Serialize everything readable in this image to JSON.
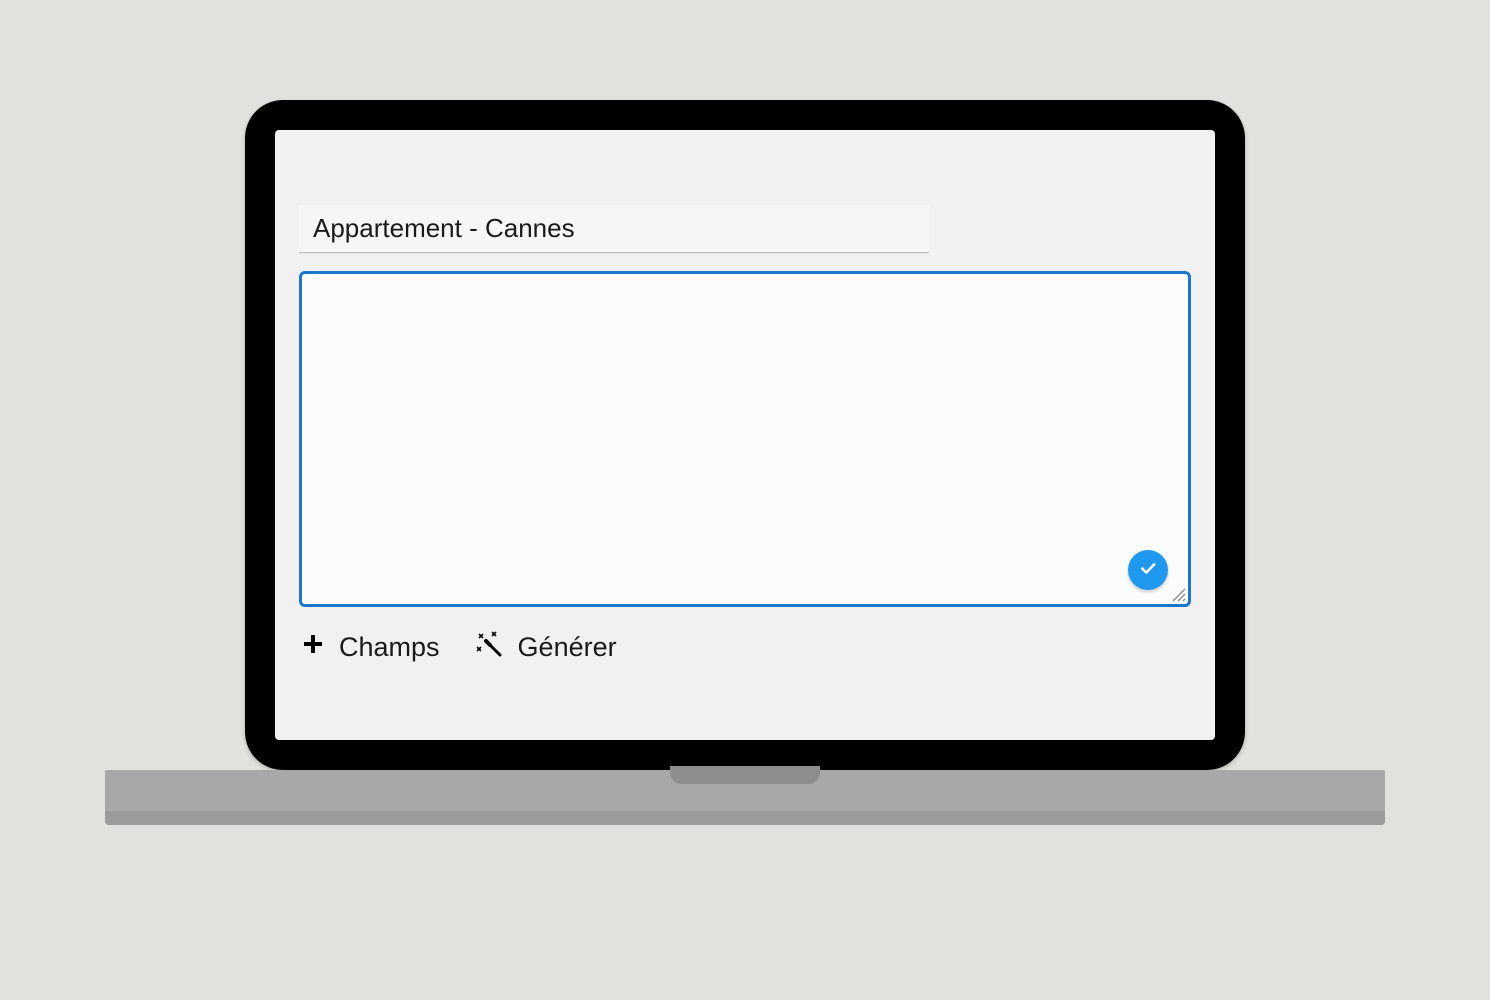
{
  "title_input": {
    "value": "Appartement - Cannes"
  },
  "content_area": {
    "text": ""
  },
  "toolbar": {
    "champs_label": "Champs",
    "generer_label": "Générer"
  },
  "colors": {
    "accent": "#1976c9",
    "button_primary": "#1f98ef"
  }
}
